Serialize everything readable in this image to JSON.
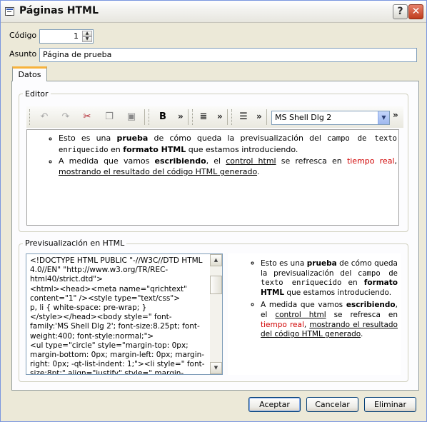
{
  "window": {
    "title": "Páginas HTML",
    "help_label": "?",
    "close_label": "✕"
  },
  "form": {
    "code_label": "Código",
    "code_value": "1",
    "subject_label": "Asunto",
    "subject_value": "Página de prueba"
  },
  "tabs": [
    {
      "label": "Datos",
      "selected": true
    }
  ],
  "editor_group": {
    "title": "Editor",
    "toolbar": {
      "icons": [
        "undo-icon",
        "redo-icon",
        "cut-icon",
        "copy-icon",
        "paste-icon",
        "bold-icon",
        "align-icon",
        "numbered-list-icon"
      ],
      "bold_label": "B",
      "overflow_label": "»",
      "font_selected": "MS Shell Dlg 2"
    },
    "content": {
      "item1": {
        "t1": "Esto es una ",
        "b1": "prueba",
        "t2": " de cómo queda la previsualización del ",
        "mono": "campo de texto enriquecido",
        "t3": " en ",
        "b2": "formato HTML",
        "t4": " que estamos introduciendo."
      },
      "item2": {
        "t1": "A medida que vamos ",
        "b1": "escribiendo",
        "t2": ", el ",
        "u1": "control html",
        "t3": " se refresca en ",
        "red": "tiempo real",
        "t4": ", ",
        "u2": "mostrando el resultado del código HTML generado",
        "t5": "."
      }
    }
  },
  "preview_group": {
    "title": "Previsualización en HTML",
    "source_lines": [
      "<!DOCTYPE HTML PUBLIC \"-//W3C//DTD HTML 4.0//EN\" \"http://www.w3.org/TR/REC-html40/strict.dtd\">",
      "<html><head><meta name=\"qrichtext\" content=\"1\" /><style type=\"text/css\">",
      "p, li { white-space: pre-wrap; }",
      "</style></head><body style=\" font-family:'MS Shell Dlg 2'; font-size:8.25pt; font-weight:400; font-style:normal;\">",
      "<ul type=\"circle\" style=\"margin-top: 0px; margin-bottom: 0px; margin-left: 0px; margin-right: 0px; -qt-list-indent: 1;\"><li style=\" font-size:8pt;\" align=\"justify\" style=\" margin-top:0px; margin-"
    ]
  },
  "buttons": {
    "accept": "Aceptar",
    "cancel": "Cancelar",
    "delete": "Eliminar"
  },
  "colors": {
    "accent_tab": "#f7b23b",
    "link_red": "#d00000",
    "window_bg": "#ece9d8"
  }
}
